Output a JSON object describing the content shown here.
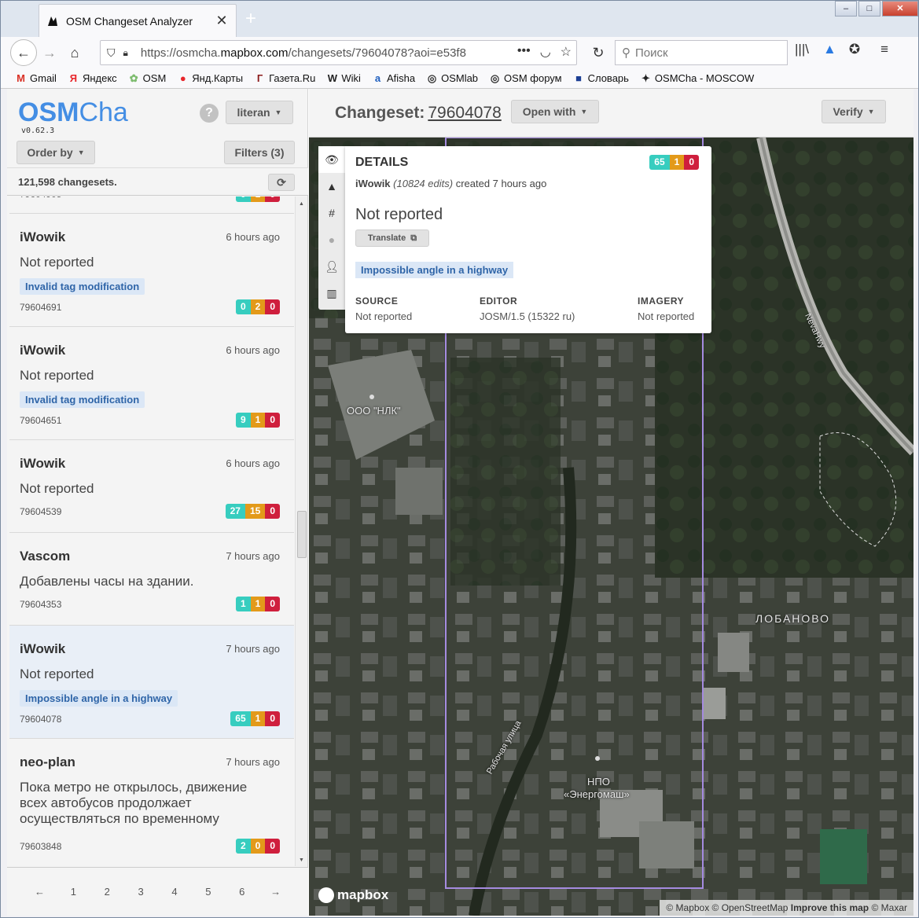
{
  "browser": {
    "tab_title": "OSM Changeset Analyzer",
    "url_prefix": "https://osmcha.",
    "url_domain": "mapbox.com",
    "url_rest": "/changesets/79604078?aoi=e53f8",
    "search_placeholder": "Поиск",
    "bookmarks": [
      {
        "label": "Gmail",
        "icon": "M",
        "color": "#d93025"
      },
      {
        "label": "Яндекс",
        "icon": "Я",
        "color": "#e8262b"
      },
      {
        "label": "OSM",
        "icon": "✿",
        "color": "#7ebc6f"
      },
      {
        "label": "Янд.Карты",
        "icon": "●",
        "color": "#e8262b"
      },
      {
        "label": "Газета.Ru",
        "icon": "Г",
        "color": "#8b1a1a"
      },
      {
        "label": "Wiki",
        "icon": "W",
        "color": "#222222"
      },
      {
        "label": "Afisha",
        "icon": "a",
        "color": "#1f5fbf"
      },
      {
        "label": "OSMlab",
        "icon": "◎",
        "color": "#333333"
      },
      {
        "label": "OSM форум",
        "icon": "◎",
        "color": "#333333"
      },
      {
        "label": "Словарь",
        "icon": "■",
        "color": "#1c3f94"
      },
      {
        "label": "OSMCha - MOSCOW",
        "icon": "✦",
        "color": "#222222"
      }
    ]
  },
  "sidebar": {
    "logo_osm": "OSM",
    "logo_cha": "Cha",
    "version": "v0.62.3",
    "help": "?",
    "user": "literan",
    "order_by": "Order by",
    "filters": "Filters (3)",
    "count": "121,598 changesets.",
    "changesets": [
      {
        "user": "iWowik",
        "time": "6 hours ago",
        "comment": "Not reported",
        "tag": "Invalid tag modification",
        "id": "79604691",
        "c": "0",
        "m": "2",
        "d": "0"
      },
      {
        "user": "iWowik",
        "time": "6 hours ago",
        "comment": "Not reported",
        "tag": "Invalid tag modification",
        "id": "79604651",
        "c": "9",
        "m": "1",
        "d": "0"
      },
      {
        "user": "iWowik",
        "time": "6 hours ago",
        "comment": "Not reported",
        "tag": "",
        "id": "79604539",
        "c": "27",
        "m": "15",
        "d": "0"
      },
      {
        "user": "Vascom",
        "time": "7 hours ago",
        "comment": "Добавлены часы на здании.",
        "tag": "",
        "id": "79604353",
        "c": "1",
        "m": "1",
        "d": "0"
      },
      {
        "user": "iWowik",
        "time": "7 hours ago",
        "comment": "Not reported",
        "tag": "Impossible angle in a highway",
        "id": "79604078",
        "c": "65",
        "m": "1",
        "d": "0"
      },
      {
        "user": "neo-plan",
        "time": "7 hours ago",
        "comment": "Пока метро не открылось, движение всех автобусов продолжает осуществляться по временному",
        "tag": "",
        "id": "79603848",
        "c": "2",
        "m": "0",
        "d": "0"
      }
    ],
    "pagination": [
      "←",
      "1",
      "2",
      "3",
      "4",
      "5",
      "6",
      "→"
    ]
  },
  "header": {
    "changeset_label": "Changeset:",
    "changeset_number": "79604078",
    "open_with": "Open with",
    "verify": "Verify"
  },
  "details": {
    "title": "DETAILS",
    "user": "iWowik",
    "edits": "(10824 edits)",
    "created": "created 7 hours ago",
    "comment": "Not reported",
    "translate": "Translate",
    "tag": "Impossible angle in a highway",
    "badges": {
      "c": "65",
      "m": "1",
      "d": "0"
    },
    "source_label": "SOURCE",
    "source_value": "Not reported",
    "editor_label": "EDITOR",
    "editor_value": "JOSM/1.5 (15322 ru)",
    "imagery_label": "IMAGERY",
    "imagery_value": "Not reported"
  },
  "map": {
    "labels": {
      "nlk": "ООО \"НЛК\"",
      "lobanovo": "ЛОБАНОВО",
      "npo": "НПО",
      "energomash": "«Энергомаш»",
      "street": "Рабочая улица",
      "highway": "NevaHwy"
    },
    "mapbox": "mapbox",
    "attribution_1": "© Mapbox © OpenStreetMap",
    "attribution_2": "Improve this map",
    "attribution_3": "© Maxar"
  }
}
